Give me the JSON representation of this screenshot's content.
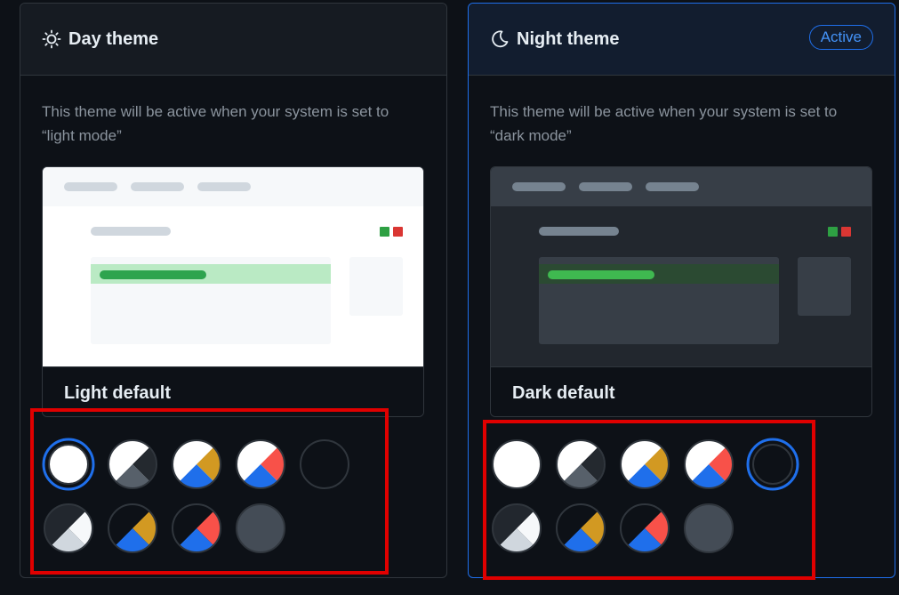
{
  "day_panel": {
    "title": "Day theme",
    "icon": "sun-icon",
    "description": "This theme will be active when your system is set to “light mode”",
    "preview_label": "Light default",
    "selected_swatch": 0
  },
  "night_panel": {
    "title": "Night theme",
    "icon": "moon-icon",
    "badge": "Active",
    "description": "This theme will be active when your system is set to “dark mode”",
    "preview_label": "Dark default",
    "selected_swatch": 4
  },
  "swatches": [
    {
      "name": "light-default"
    },
    {
      "name": "light-high-contrast"
    },
    {
      "name": "light-protanopia-deuteranopia"
    },
    {
      "name": "light-tritanopia"
    },
    {
      "name": "dark-default"
    },
    {
      "name": "light-colorblind"
    },
    {
      "name": "dark-protanopia-deuteranopia"
    },
    {
      "name": "dark-tritanopia"
    },
    {
      "name": "dark-dimmed"
    }
  ],
  "colors": {
    "accent": "#1f6feb",
    "highlight_box": "#e00000",
    "success": "#2ea043",
    "danger": "#da3633"
  }
}
